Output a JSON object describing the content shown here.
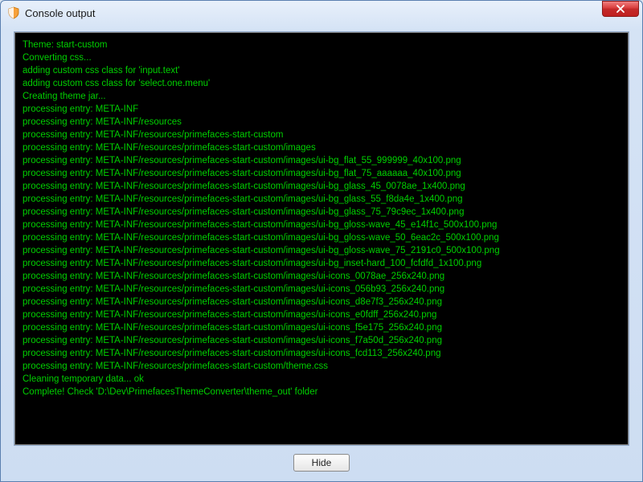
{
  "window": {
    "title": "Console output"
  },
  "console": {
    "lines": [
      "Theme: start-custom",
      "Converting css...",
      "adding custom css class for 'input.text'",
      "adding custom css class for 'select.one.menu'",
      "Creating theme jar...",
      "processing entry: META-INF",
      "processing entry: META-INF/resources",
      "processing entry: META-INF/resources/primefaces-start-custom",
      "processing entry: META-INF/resources/primefaces-start-custom/images",
      "processing entry: META-INF/resources/primefaces-start-custom/images/ui-bg_flat_55_999999_40x100.png",
      "processing entry: META-INF/resources/primefaces-start-custom/images/ui-bg_flat_75_aaaaaa_40x100.png",
      "processing entry: META-INF/resources/primefaces-start-custom/images/ui-bg_glass_45_0078ae_1x400.png",
      "processing entry: META-INF/resources/primefaces-start-custom/images/ui-bg_glass_55_f8da4e_1x400.png",
      "processing entry: META-INF/resources/primefaces-start-custom/images/ui-bg_glass_75_79c9ec_1x400.png",
      "processing entry: META-INF/resources/primefaces-start-custom/images/ui-bg_gloss-wave_45_e14f1c_500x100.png",
      "processing entry: META-INF/resources/primefaces-start-custom/images/ui-bg_gloss-wave_50_6eac2c_500x100.png",
      "processing entry: META-INF/resources/primefaces-start-custom/images/ui-bg_gloss-wave_75_2191c0_500x100.png",
      "processing entry: META-INF/resources/primefaces-start-custom/images/ui-bg_inset-hard_100_fcfdfd_1x100.png",
      "processing entry: META-INF/resources/primefaces-start-custom/images/ui-icons_0078ae_256x240.png",
      "processing entry: META-INF/resources/primefaces-start-custom/images/ui-icons_056b93_256x240.png",
      "processing entry: META-INF/resources/primefaces-start-custom/images/ui-icons_d8e7f3_256x240.png",
      "processing entry: META-INF/resources/primefaces-start-custom/images/ui-icons_e0fdff_256x240.png",
      "processing entry: META-INF/resources/primefaces-start-custom/images/ui-icons_f5e175_256x240.png",
      "processing entry: META-INF/resources/primefaces-start-custom/images/ui-icons_f7a50d_256x240.png",
      "processing entry: META-INF/resources/primefaces-start-custom/images/ui-icons_fcd113_256x240.png",
      "processing entry: META-INF/resources/primefaces-start-custom/theme.css",
      "Cleaning temporary data... ok",
      "Complete! Check 'D:\\Dev\\PrimefacesThemeConverter\\theme_out' folder"
    ]
  },
  "buttons": {
    "hide": "Hide"
  },
  "colors": {
    "console_fg": "#00d000",
    "console_bg": "#000000"
  }
}
